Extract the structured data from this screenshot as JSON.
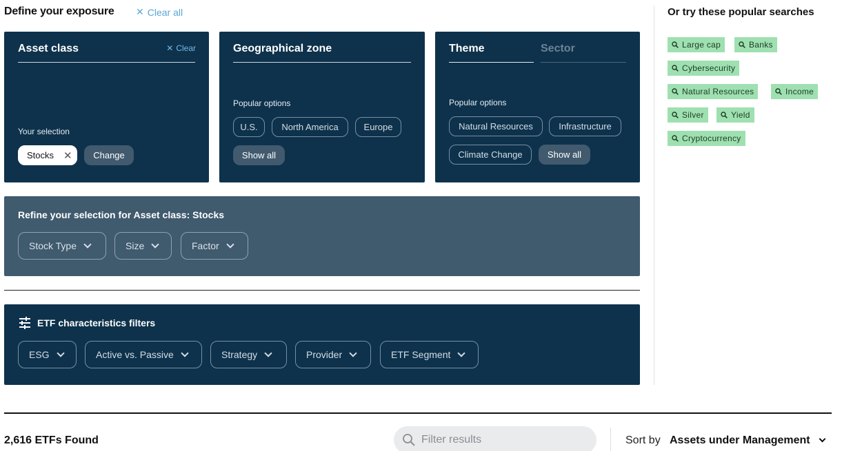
{
  "header": {
    "title": "Define your exposure",
    "clear_all": "Clear all"
  },
  "asset_class": {
    "title": "Asset class",
    "clear": "Clear",
    "your_selection_label": "Your selection",
    "selected": "Stocks",
    "change": "Change"
  },
  "geo": {
    "title": "Geographical zone",
    "popular_label": "Popular options",
    "options": [
      "U.S.",
      "North America",
      "Europe"
    ],
    "show_all": "Show all"
  },
  "theme": {
    "tab_theme": "Theme",
    "tab_sector": "Sector",
    "popular_label": "Popular options",
    "options": [
      "Natural Resources",
      "Infrastructure",
      "Climate Change"
    ],
    "show_all": "Show all"
  },
  "refine": {
    "title": "Refine your selection for Asset class: Stocks",
    "dropdowns": [
      "Stock Type",
      "Size",
      "Factor"
    ]
  },
  "etf_filters": {
    "title": "ETF characteristics filters",
    "dropdowns": [
      "ESG",
      "Active vs. Passive",
      "Strategy",
      "Provider",
      "ETF Segment"
    ]
  },
  "popular": {
    "title": "Or try these popular searches",
    "tags": [
      "Large cap",
      "Banks",
      "Cybersecurity",
      "Natural Resources",
      "Income",
      "Silver",
      "Yield",
      "Cryptocurrency"
    ]
  },
  "results": {
    "found": "2,616 ETFs Found",
    "filter_placeholder": "Filter results",
    "sort_label": "Sort by",
    "sort_value": "Assets under Management"
  },
  "colors": {
    "card_bg": "#0e324c",
    "refine_bg": "#405a6e",
    "tag_bg": "#9fe0b0",
    "link": "#5aa7d6"
  }
}
